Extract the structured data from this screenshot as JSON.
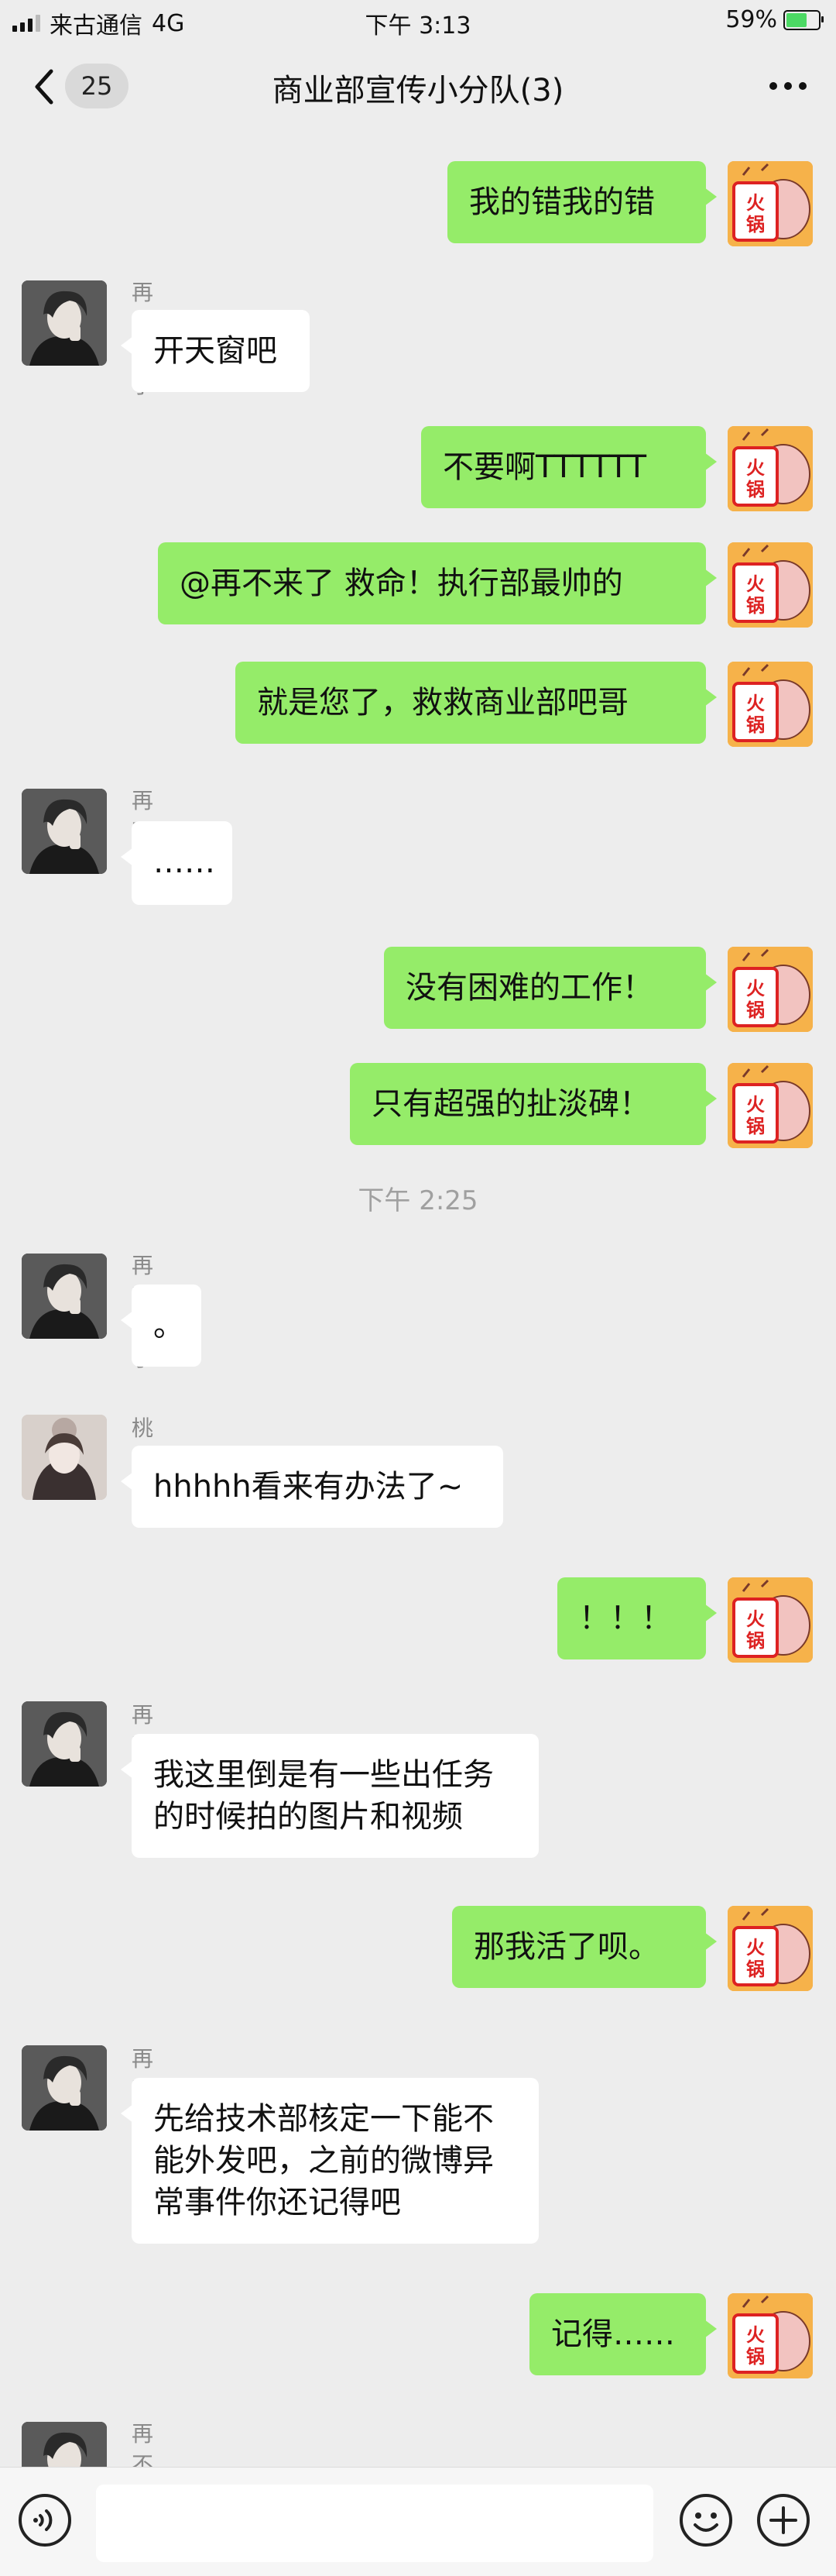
{
  "status_bar": {
    "carrier": "来古通信",
    "network": "4G",
    "time": "下午 3:13",
    "battery": "59%"
  },
  "nav": {
    "back_count": "25",
    "title": "商业部宣传小分队(3)"
  },
  "messages": [
    {
      "side": "me",
      "text": "我的错我的错"
    },
    {
      "side": "other",
      "sender": "再不来了",
      "text": "开天窗吧"
    },
    {
      "side": "me",
      "text": "不要啊TTTTTT"
    },
    {
      "side": "me",
      "text": "@再不来了 救命！执行部最帅的"
    },
    {
      "side": "me",
      "text": "就是您了，救救商业部吧哥"
    },
    {
      "side": "other",
      "sender": "再不来了",
      "text": "……"
    },
    {
      "side": "me",
      "text": "没有困难的工作！"
    },
    {
      "side": "me",
      "text": "只有超强的扯淡碑！"
    },
    {
      "side": "other",
      "sender": "再不来了",
      "text": "。"
    },
    {
      "side": "other",
      "sender": "桃妹",
      "text": "hhhhh看来有办法了~"
    },
    {
      "side": "me",
      "text": "！！！"
    },
    {
      "side": "other",
      "sender": "再不来了",
      "text": "我这里倒是有一些出任务\n的时候拍的图片和视频"
    },
    {
      "side": "me",
      "text": "那我活了呗。"
    },
    {
      "side": "other",
      "sender": "再不来了",
      "text": "先给技术部核定一下能不\n能外发吧，之前的微博异\n常事件你还记得吧"
    },
    {
      "side": "me",
      "text": "记得……"
    },
    {
      "side": "other",
      "sender": "再不来了",
      "text": ""
    }
  ],
  "timestamp": "下午 2:25",
  "avatar_text": "火锅",
  "input": {
    "placeholder": ""
  },
  "colors": {
    "my_bubble": "#95ec69",
    "other_bubble": "#ffffff",
    "background": "#ededed"
  }
}
